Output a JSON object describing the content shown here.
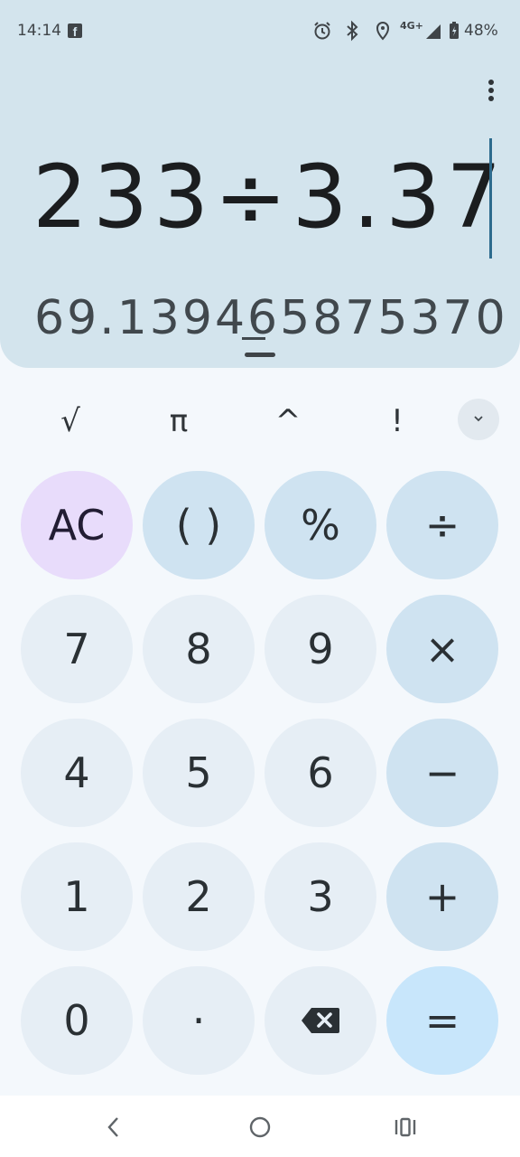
{
  "status": {
    "time": "14:14",
    "notification_icons": [
      "facebook-icon"
    ],
    "system_icons": [
      "alarm-icon",
      "bluetooth-icon",
      "location-icon",
      "4g-icon",
      "signal-icon",
      "battery-icon"
    ],
    "network": "4G+",
    "battery": "48%"
  },
  "display": {
    "expression": "233÷3.37",
    "result": "69.139465875370"
  },
  "scientific": {
    "sqrt": "√",
    "pi": "π",
    "power": "^",
    "factorial": "!"
  },
  "keypad": {
    "clear": "AC",
    "parens": "( )",
    "percent": "%",
    "divide": "÷",
    "seven": "7",
    "eight": "8",
    "nine": "9",
    "multiply": "×",
    "four": "4",
    "five": "5",
    "six": "6",
    "minus": "−",
    "one": "1",
    "two": "2",
    "three": "3",
    "plus": "+",
    "zero": "0",
    "decimal": "·",
    "equals": "="
  },
  "icons": {
    "menu": "more-vert-icon",
    "expand": "chevron-down-icon",
    "backspace": "backspace-icon",
    "nav_back": "back-icon",
    "nav_home": "home-icon",
    "nav_recents": "recents-icon"
  },
  "colors": {
    "display_bg": "#d3e4ed",
    "keypad_bg": "#f4f8fc",
    "number_key": "#e6eef5",
    "operator_key": "#cfe3f1",
    "clear_key": "#e8dcfb",
    "equals_key": "#c8e6fb",
    "cursor": "#2d6b8e"
  }
}
